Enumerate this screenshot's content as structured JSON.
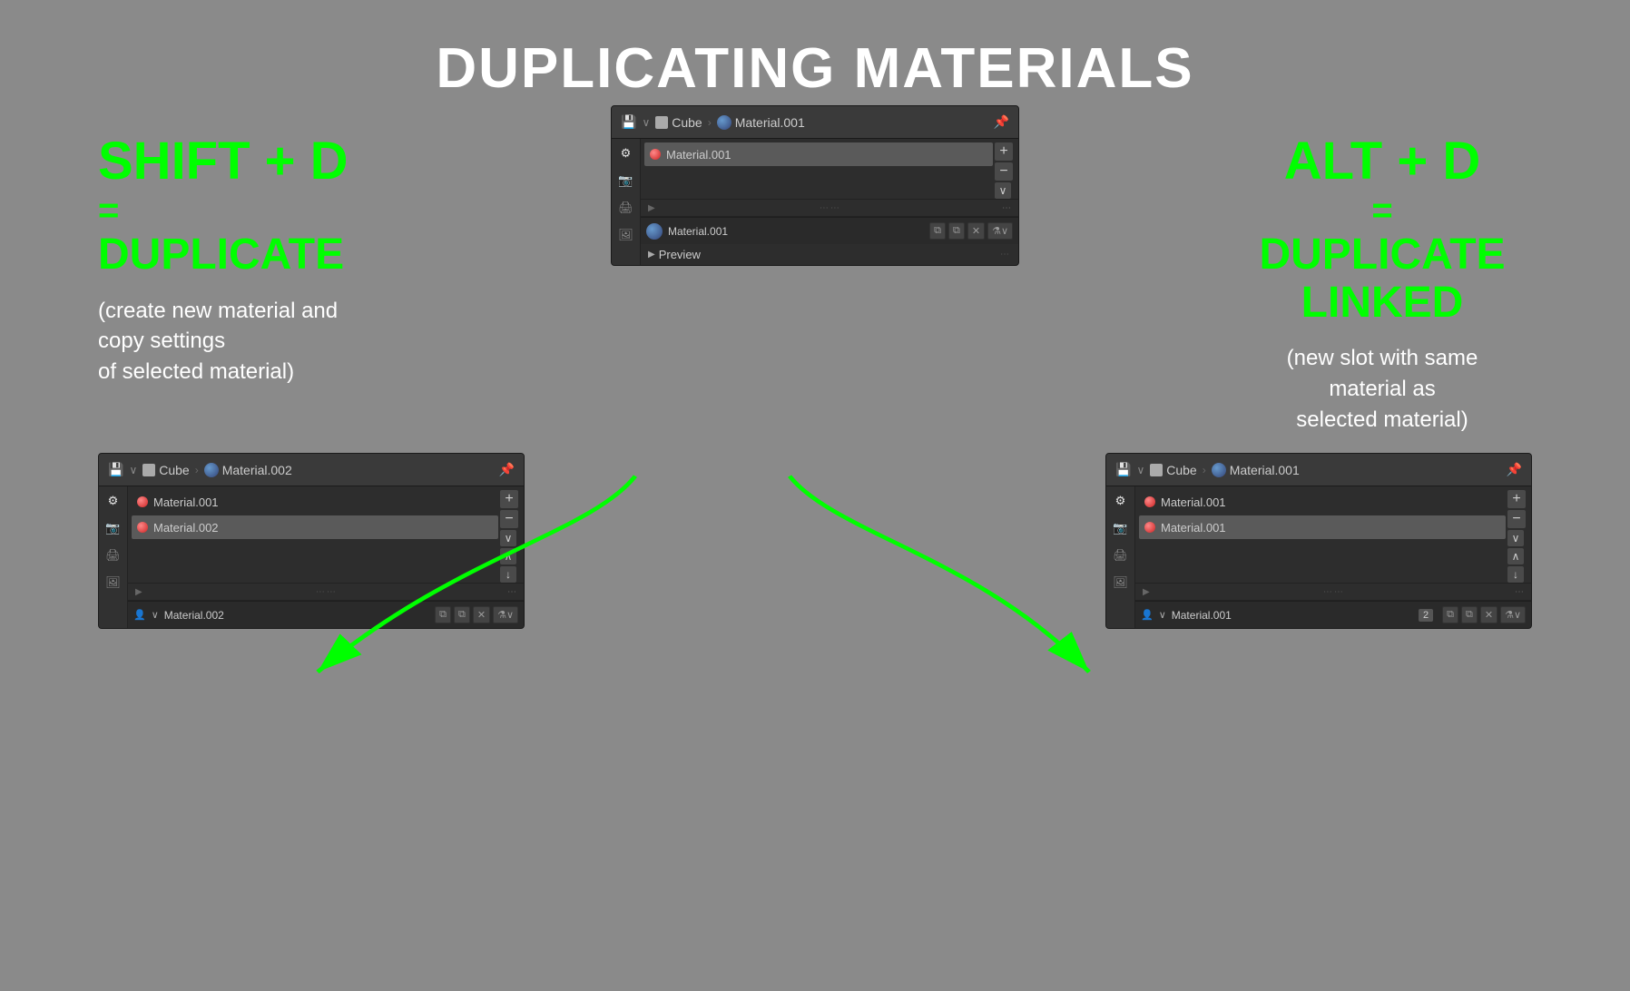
{
  "page": {
    "title": "DUPLICATING MATERIALS",
    "background": "#8a8a8a"
  },
  "shift_d": {
    "key_combo": "SHIFT + D",
    "equals": "=",
    "action": "DUPLICATE",
    "description": "(create new material and\ncopy settings\nof selected material)"
  },
  "alt_d": {
    "key_combo": "ALT + D",
    "equals": "=",
    "action": "DUPLICATE LINKED",
    "description": "(new slot with same\nmaterial as\nselected material)"
  },
  "top_panel": {
    "cube_label": "Cube",
    "material_label": "Material.001",
    "material_list": [
      {
        "name": "Material.001",
        "selected": true
      }
    ],
    "slot_name": "Material.001"
  },
  "bottom_left_panel": {
    "cube_label": "Cube",
    "material_label": "Material.002",
    "material_list": [
      {
        "name": "Material.001",
        "selected": false
      },
      {
        "name": "Material.002",
        "selected": true
      }
    ],
    "slot_name": "Material.002"
  },
  "bottom_right_panel": {
    "cube_label": "Cube",
    "material_label": "Material.001",
    "material_list": [
      {
        "name": "Material.001",
        "selected": false
      },
      {
        "name": "Material.001",
        "selected": true
      }
    ],
    "slot_name": "Material.001",
    "number_badge": "2"
  },
  "icons": {
    "pin": "📌",
    "plus": "+",
    "minus": "−",
    "chevron_down": "∨",
    "chevron_up": "∧",
    "triangle_right": "▶",
    "copy": "⧉",
    "x": "✕"
  }
}
